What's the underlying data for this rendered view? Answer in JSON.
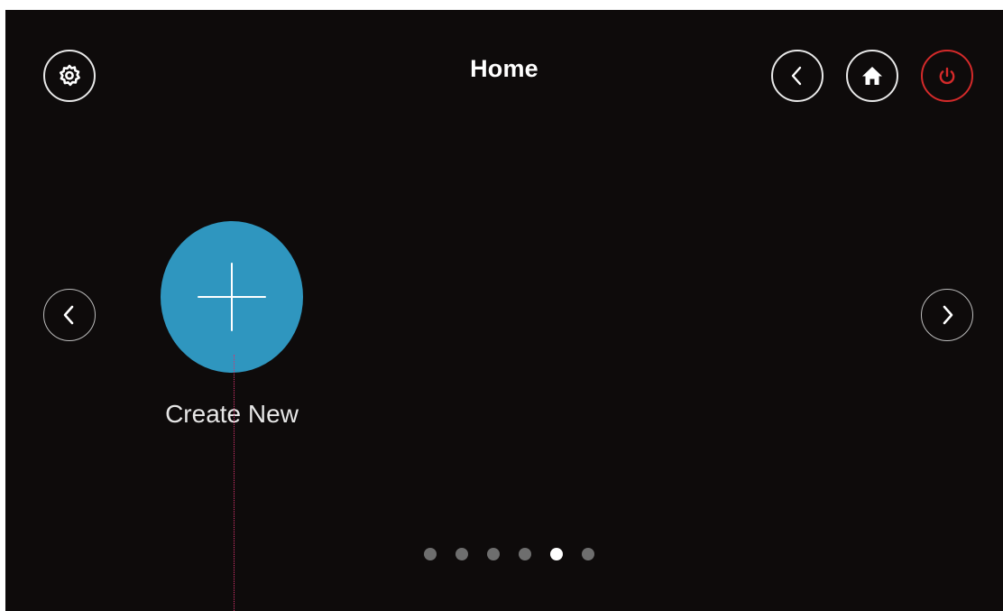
{
  "header": {
    "title": "Home"
  },
  "tiles": [
    {
      "label": "Create New",
      "icon": "plus-icon",
      "color": "#2f96bf"
    }
  ],
  "pager": {
    "total": 6,
    "active_index": 4
  },
  "colors": {
    "background": "#0e0b0b",
    "accent": "#2f96bf",
    "power": "#d42a2a",
    "dot_inactive": "#6e6e6e",
    "dot_active": "#ffffff"
  },
  "icons": {
    "settings": "gear-icon",
    "back": "chevron-left-icon",
    "home": "home-icon",
    "power": "power-icon",
    "prev_page": "chevron-left-icon",
    "next_page": "chevron-right-icon"
  }
}
